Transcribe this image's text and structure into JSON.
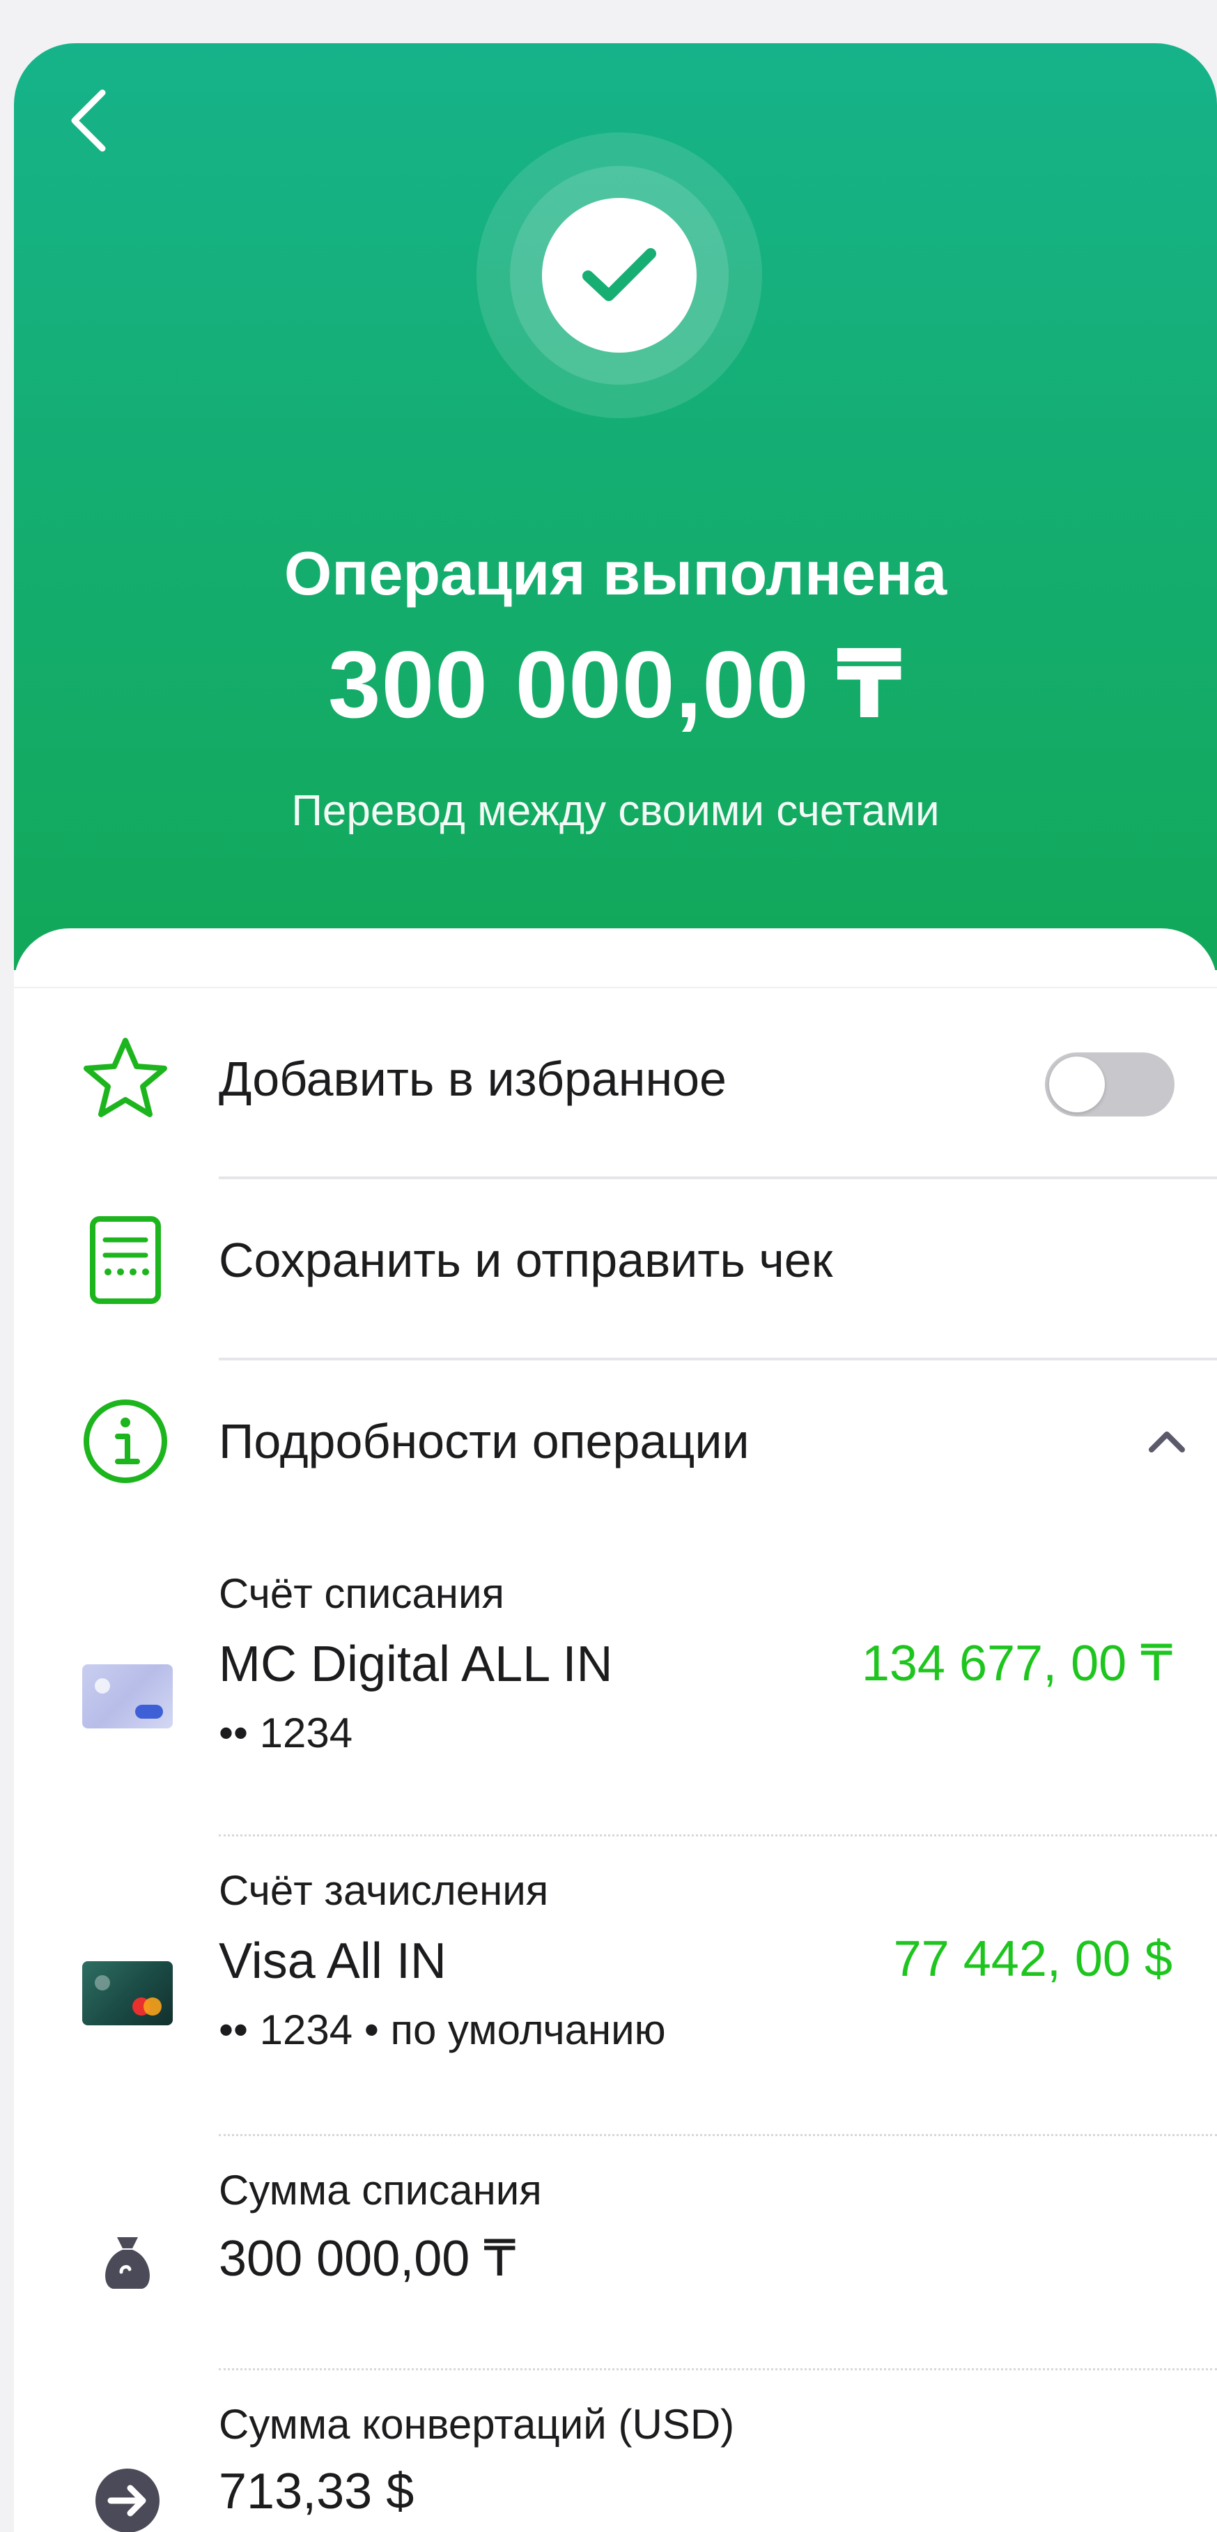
{
  "header": {
    "status_title": "Операция выполнена",
    "amount": "300 000,00 ₸",
    "subtitle": "Перевод между своими счетами"
  },
  "actions": {
    "favorite_label": "Добавить в избранное",
    "favorite_enabled": false,
    "receipt_label": "Сохранить и отправить чек",
    "details_label": "Подробности операции",
    "details_expanded": true
  },
  "details": {
    "debit_account": {
      "caption": "Счёт списания",
      "name": "MC Digital ALL IN",
      "sub": "•• 1234",
      "balance": "134 677, 00 ₸"
    },
    "credit_account": {
      "caption": "Счёт зачисления",
      "name": "Visa All IN",
      "sub": "•• 1234 • по умолчанию",
      "balance": "77 442, 00 $"
    },
    "debit_amount": {
      "caption": "Сумма списания",
      "value": "300 000,00 ₸"
    },
    "conversion_amount": {
      "caption": "Сумма конвертаций (USD)",
      "value": "713,33 $"
    }
  },
  "colors": {
    "header_green": "#14ad6e",
    "accent_green": "#1ec51e",
    "icon_green": "#1db51d",
    "muted_icon": "#4a4a58"
  },
  "icons": {
    "back": "chevron-left-icon",
    "success": "checkmark-icon",
    "favorite": "star-icon",
    "receipt": "receipt-icon",
    "details": "info-icon",
    "collapse": "chevron-up-icon",
    "debit_amount": "money-bag-icon",
    "conversion": "arrow-right-circle-icon"
  }
}
